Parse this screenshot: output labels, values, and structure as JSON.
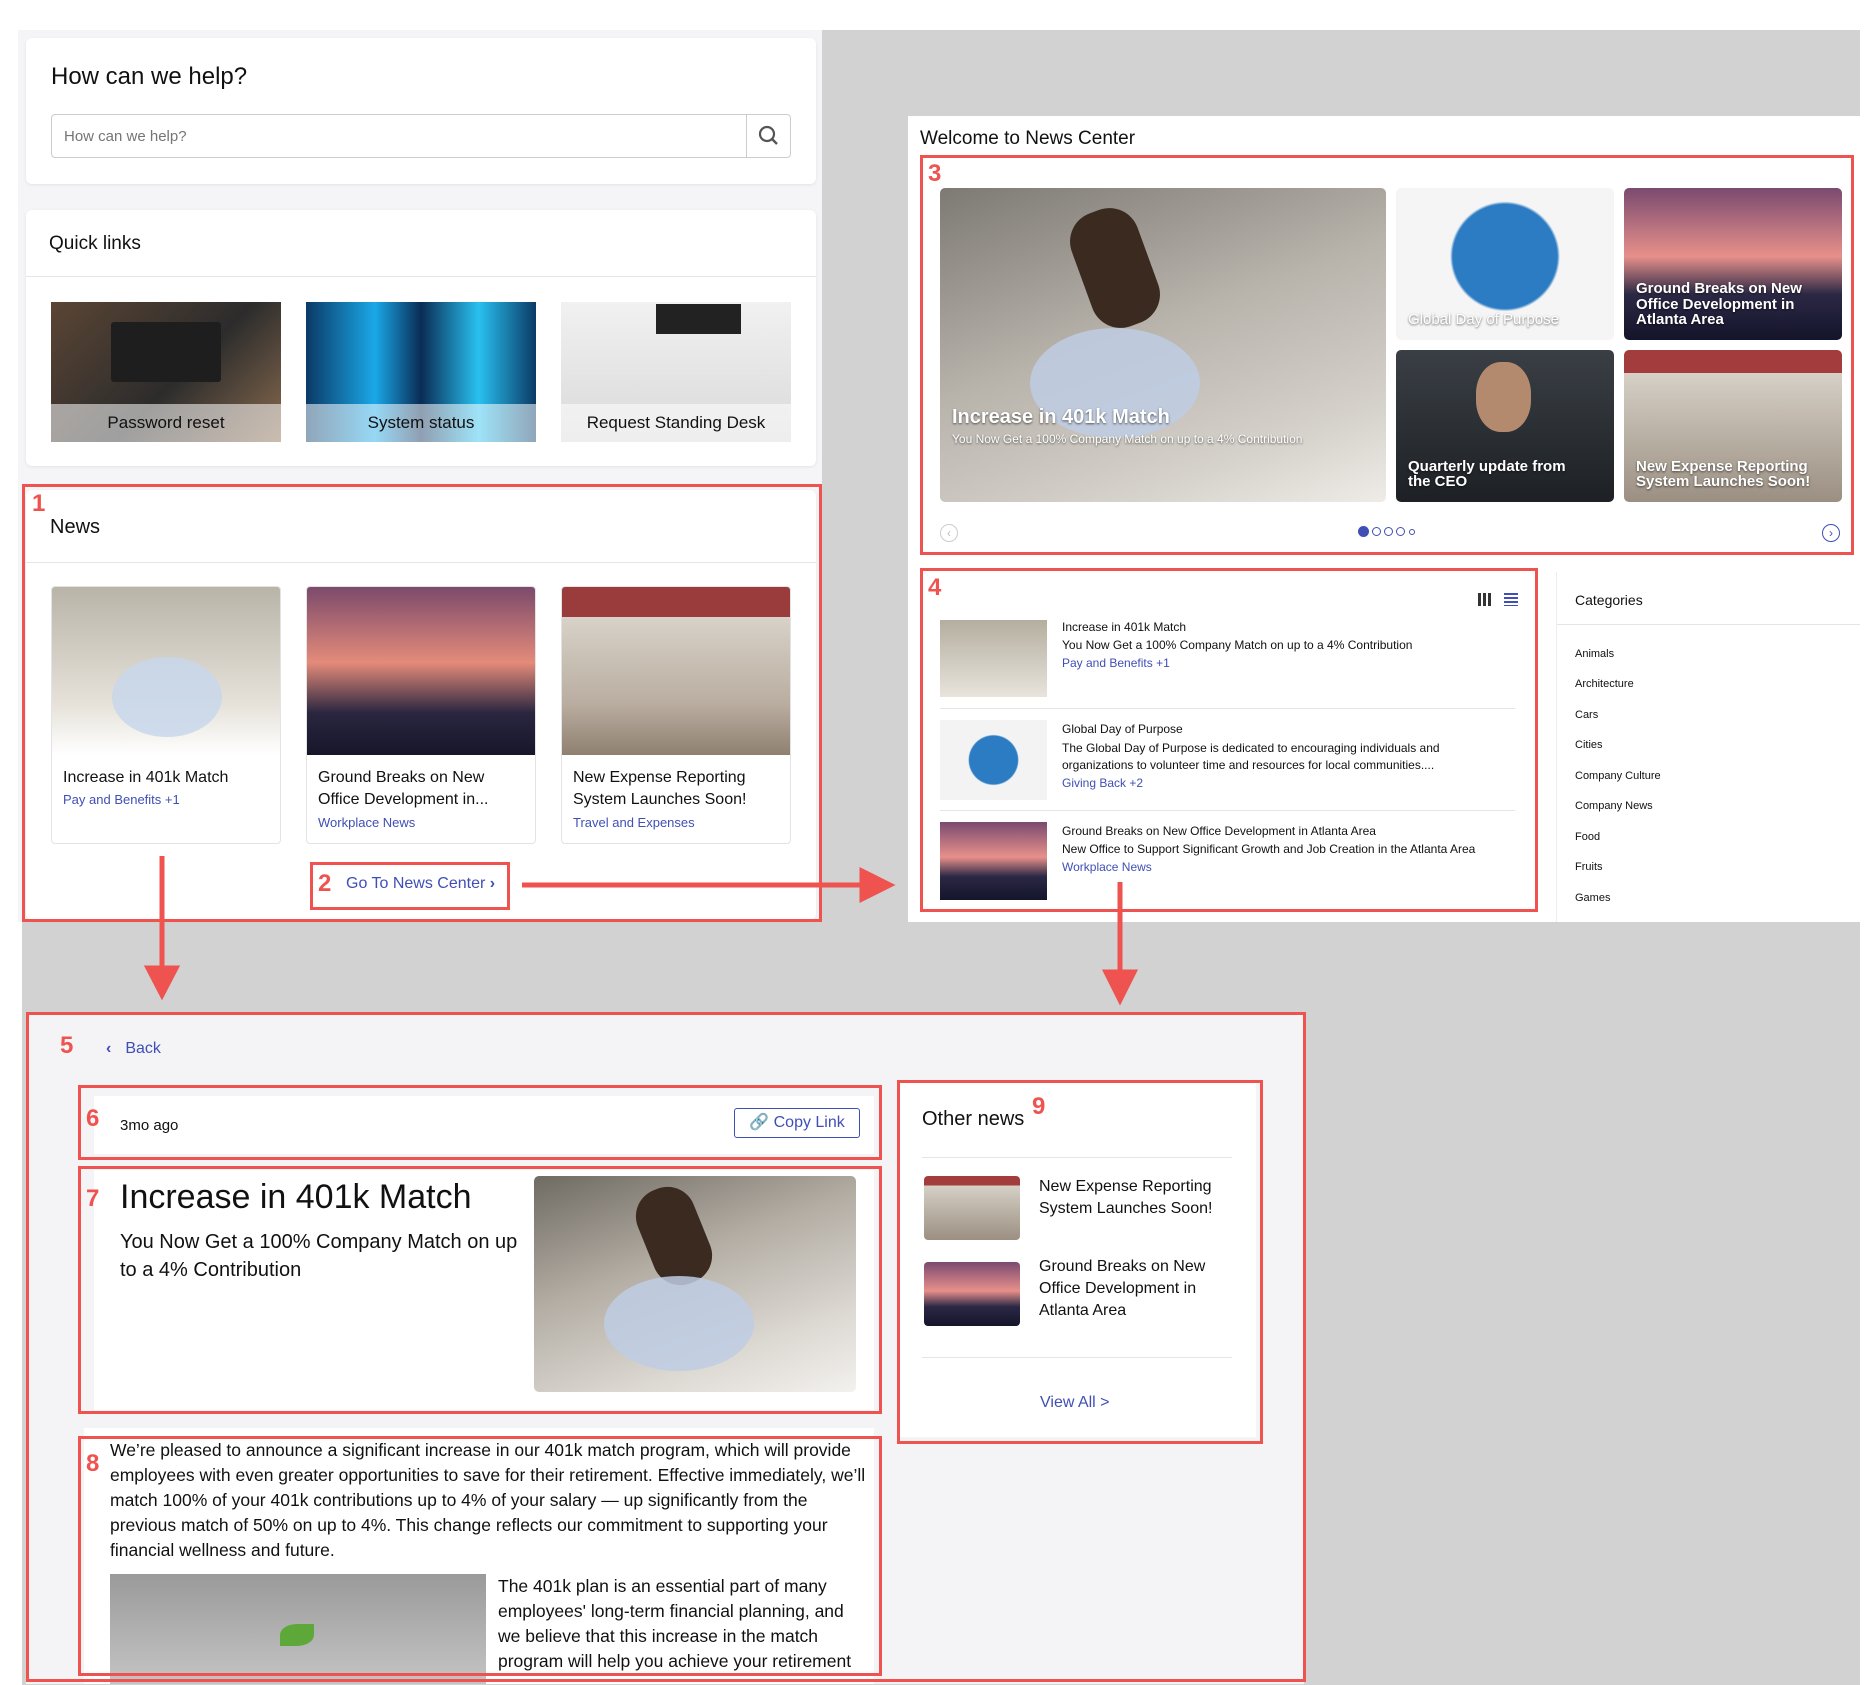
{
  "help": {
    "title": "How can we help?",
    "placeholder": "How can we help?"
  },
  "quick_links": {
    "title": "Quick links",
    "items": [
      "Password reset",
      "System status",
      "Request Standing Desk"
    ]
  },
  "news": {
    "title": "News",
    "cards": [
      {
        "title": "Increase in 401k Match",
        "tag": "Pay and Benefits",
        "extra": "+1"
      },
      {
        "title": "Ground Breaks on New Office Development in...",
        "tag": "Workplace News"
      },
      {
        "title": "New Expense Reporting System Launches Soon!",
        "tag": "Travel and Expenses"
      }
    ],
    "cta": "Go To News Center"
  },
  "news_center": {
    "title": "Welcome to News Center",
    "hero": {
      "title": "Increase in 401k Match",
      "subtitle": "You Now Get a 100% Company Match on up to a 4% Contribution"
    },
    "tiles": [
      "Global Day of Purpose",
      "Ground Breaks on New Office Development in Atlanta Area",
      "Quarterly update from the CEO",
      "New Expense Reporting System Launches Soon!"
    ],
    "list": [
      {
        "title": "Increase in 401k Match",
        "desc": "You Now Get a 100% Company Match on up to a 4% Contribution",
        "tag": "Pay and Benefits",
        "extra": "+1"
      },
      {
        "title": "Global Day of Purpose",
        "desc": "The Global Day of Purpose is dedicated to encouraging individuals and organizations to volunteer time and resources for local communities....",
        "tag": "Giving Back",
        "extra": "+2"
      },
      {
        "title": "Ground Breaks on New Office Development in Atlanta Area",
        "desc": "New Office to Support Significant Growth and Job Creation in the Atlanta Area",
        "tag": "Workplace News",
        "extra": ""
      }
    ],
    "categories_title": "Categories",
    "categories": [
      "Animals",
      "Architecture",
      "Cars",
      "Cities",
      "Company Culture",
      "Company News",
      "Food",
      "Fruits",
      "Games"
    ]
  },
  "article": {
    "back": "Back",
    "time": "3mo ago",
    "copy": "Copy Link",
    "title": "Increase in 401k Match",
    "subtitle": "You Now Get a 100% Company Match on up to a 4% Contribution",
    "body": "We’re pleased to announce a significant increase in our 401k match program, which will provide employees with even greater opportunities to save for their retirement. Effective immediately, we’ll match 100% of your 401k contributions up to 4% of your salary — up significantly from the previous match of 50% on up to 4%. This change reflects our commitment to supporting your financial wellness and future.",
    "body2": "The 401k plan is an essential part of many employees' long-term financial planning, and we believe that this increase in the match program will help you achieve your retirement"
  },
  "other_news": {
    "title": "Other news",
    "items": [
      "New Expense Reporting System Launches Soon!",
      "Ground Breaks on New Office Development in Atlanta Area"
    ],
    "view_all": "View All >"
  },
  "annotations": [
    "1",
    "2",
    "3",
    "4",
    "5",
    "6",
    "7",
    "8",
    "9"
  ],
  "colors": {
    "annotation": "#ef5350",
    "link": "#3f4fb5"
  }
}
